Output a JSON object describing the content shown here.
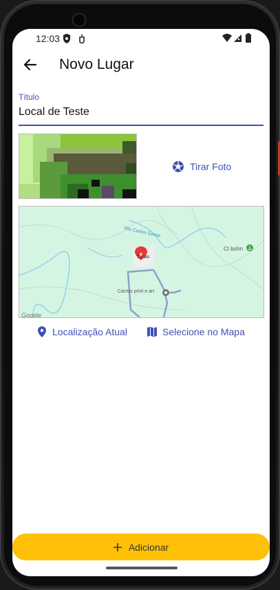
{
  "status_bar": {
    "time": "12:03"
  },
  "appbar": {
    "title": "Novo Lugar"
  },
  "title_field": {
    "label": "Título",
    "value": "Local de Teste"
  },
  "photo": {
    "take_photo_label": "Tirar Foto"
  },
  "map": {
    "labels": {
      "river": "Rio Carlos Gorse",
      "city": "Tunas",
      "place_right": "Ct bohn",
      "shop": "Cactus print e art",
      "watermark": "Google",
      "marker_letter": "A"
    }
  },
  "location_actions": {
    "current_location_label": "Localização Atual",
    "select_on_map_label": "Selecione no Mapa"
  },
  "add_button": {
    "label": "Adicionar"
  },
  "colors": {
    "primary": "#3f51b5",
    "accent": "#ffc107",
    "map_bg": "#d5f5e3"
  }
}
